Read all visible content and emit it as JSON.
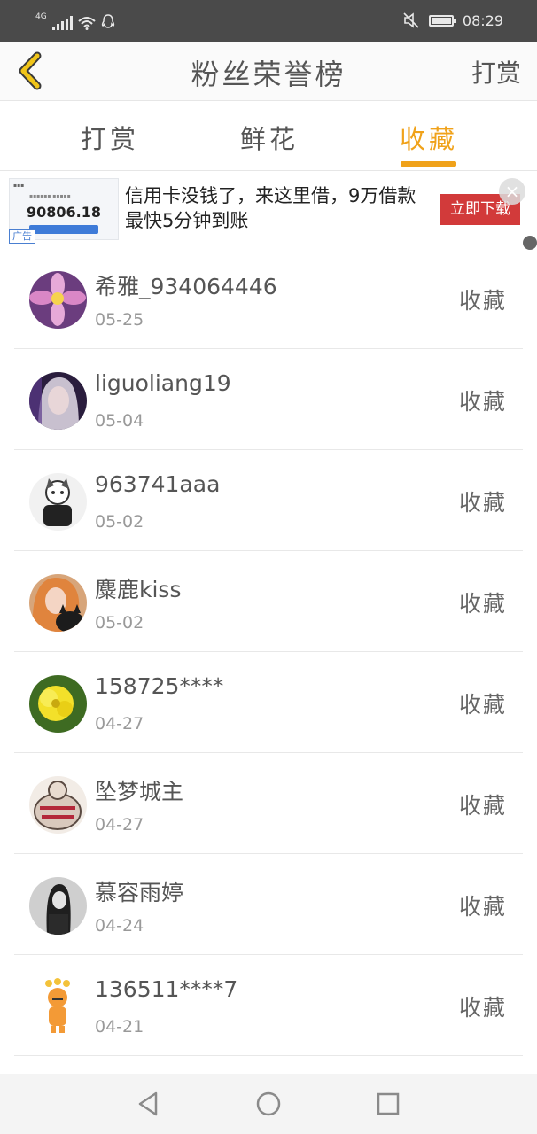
{
  "status_bar": {
    "network": "4G",
    "time": "08:29"
  },
  "header": {
    "title": "粉丝荣誉榜",
    "action": "打赏"
  },
  "tabs": [
    {
      "label": "打赏",
      "active": false
    },
    {
      "label": "鲜花",
      "active": false
    },
    {
      "label": "收藏",
      "active": true
    }
  ],
  "ad": {
    "thumb_amount": "90806.18",
    "tag": "广告",
    "text": "信用卡没钱了，来这里借，9万借款最快5分钟到账",
    "cta": "立即下载"
  },
  "fans": [
    {
      "name": "希雅_934064446",
      "date": "05-25",
      "action": "收藏",
      "avatar": "flower-pink"
    },
    {
      "name": "liguoliang19",
      "date": "05-04",
      "action": "收藏",
      "avatar": "girl-purple"
    },
    {
      "name": "963741aaa",
      "date": "05-02",
      "action": "收藏",
      "avatar": "cartoon-cat"
    },
    {
      "name": "麋鹿kiss",
      "date": "05-02",
      "action": "收藏",
      "avatar": "girl-cat"
    },
    {
      "name": "158725****",
      "date": "04-27",
      "action": "收藏",
      "avatar": "yellow-flower"
    },
    {
      "name": "坠梦城主",
      "date": "04-27",
      "action": "收藏",
      "avatar": "fatty-forever"
    },
    {
      "name": "慕容雨婷",
      "date": "04-24",
      "action": "收藏",
      "avatar": "girl-bw"
    },
    {
      "name": "136511****7",
      "date": "04-21",
      "action": "收藏",
      "avatar": "tiger"
    }
  ],
  "colors": {
    "accent": "#f0a21a",
    "status_bar": "#4a4a4a",
    "cta": "#d23a3a"
  }
}
